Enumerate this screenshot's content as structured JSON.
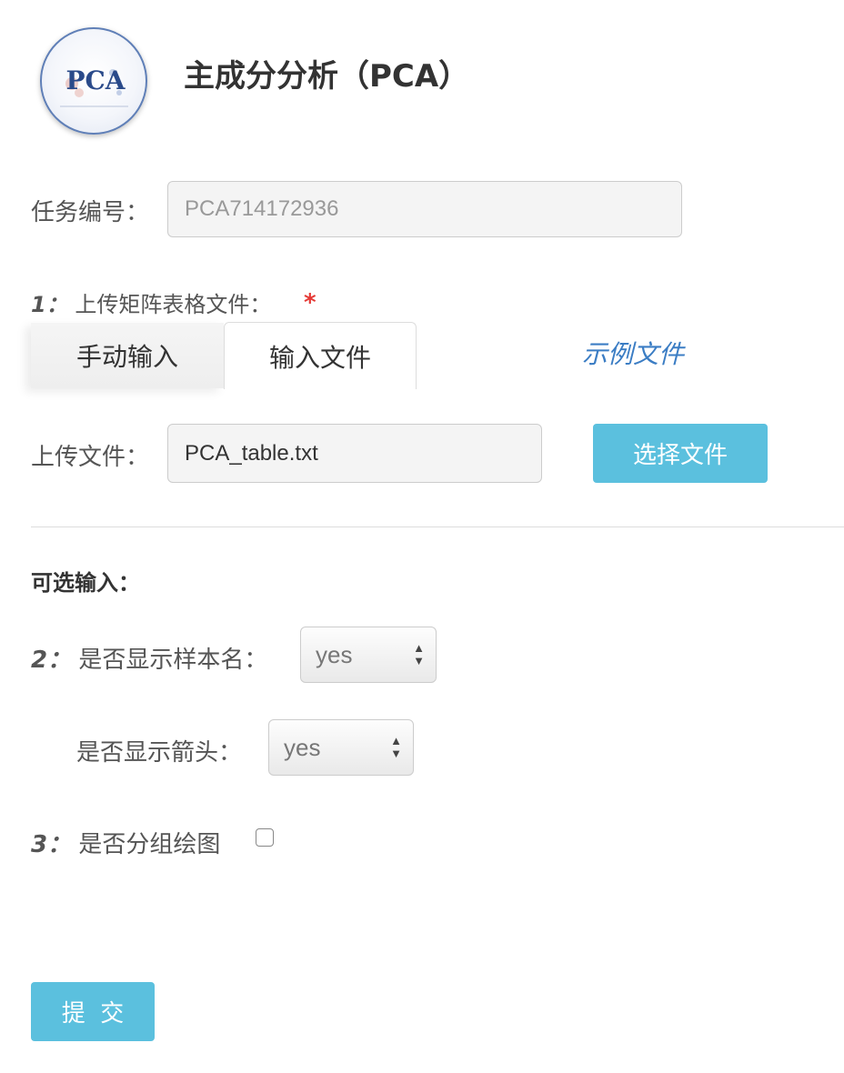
{
  "header": {
    "logo_text": "PCA",
    "title": "主成分分析（PCA）"
  },
  "task": {
    "label": "任务编号：",
    "placeholder": "PCA714172936"
  },
  "step1": {
    "number": "1：",
    "label": "上传矩阵表格文件：",
    "required_mark": "*",
    "tabs": [
      {
        "label": "手动输入",
        "active": false
      },
      {
        "label": "输入文件",
        "active": true
      }
    ],
    "example_link": "示例文件",
    "upload_label": "上传文件：",
    "file_value": "PCA_table.txt",
    "choose_button": "选择文件"
  },
  "optional": {
    "title": "可选输入："
  },
  "step2": {
    "number": "2：",
    "sample_label": "是否显示样本名：",
    "sample_value": "yes",
    "arrow_label": "是否显示箭头：",
    "arrow_value": "yes"
  },
  "step3": {
    "number": "3：",
    "label": "是否分组绘图",
    "checked": false
  },
  "submit_label": "提  交",
  "colors": {
    "accent": "#5bc0de",
    "link": "#3b7dc4",
    "required": "#e53935"
  }
}
